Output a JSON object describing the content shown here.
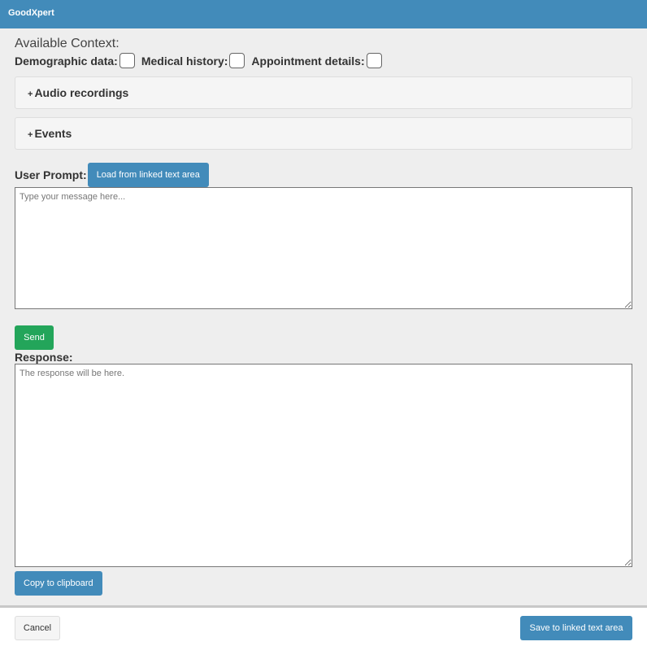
{
  "header": {
    "title": "GoodXpert"
  },
  "context": {
    "title": "Available Context:",
    "items": [
      {
        "label": "Demographic data:"
      },
      {
        "label": "Medical history:"
      },
      {
        "label": "Appointment details:"
      }
    ]
  },
  "panels": [
    {
      "icon": "+",
      "label": "Audio recordings"
    },
    {
      "icon": "+",
      "label": "Events"
    }
  ],
  "prompt": {
    "label": "User Prompt:",
    "load_button": "Load from linked text area",
    "placeholder": "Type your message here...",
    "send_button": "Send"
  },
  "response": {
    "label": "Response:",
    "placeholder": "The response will be here.",
    "copy_button": "Copy to clipboard"
  },
  "footer": {
    "cancel": "Cancel",
    "save": "Save to linked text area"
  }
}
